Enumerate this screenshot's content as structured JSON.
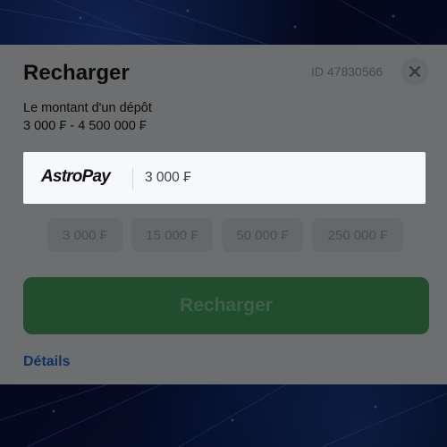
{
  "modal": {
    "title": "Recharger",
    "order_id": "ID 47830566",
    "amount_label": "Le montant d'un dépôt",
    "amount_range": "3 000 ₣ - 4 500 000 ₣"
  },
  "payment": {
    "provider_logo": "AstroPay",
    "amount_value": "3 000 ₣"
  },
  "quick_amounts": [
    "3 000 ₣",
    "15 000 ₣",
    "50 000 ₣",
    "250 000 ₣"
  ],
  "actions": {
    "submit_label": "Recharger",
    "details_label": "Détails"
  },
  "icons": {
    "close": "close-icon"
  },
  "colors": {
    "accent_green": "#4aa867",
    "link_blue": "#1f6fd1",
    "background_blue": "#0a1c55"
  }
}
